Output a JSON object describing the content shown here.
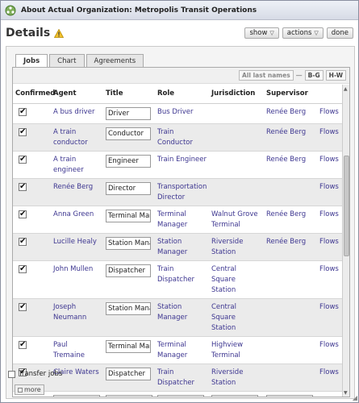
{
  "window": {
    "title": "About Actual Organization: Metropolis Transit Operations"
  },
  "header": {
    "title": "Details",
    "buttons": {
      "show": "show",
      "actions": "actions",
      "done": "done"
    }
  },
  "tabs": [
    "Jobs",
    "Chart",
    "Agreements"
  ],
  "filters": {
    "all": "All last names",
    "sep": "—",
    "bg": "B-G",
    "hw": "H-W"
  },
  "table": {
    "columns": [
      "Confirmed",
      "Agent",
      "Title",
      "Role",
      "Jurisdiction",
      "Supervisor",
      ""
    ],
    "rows": [
      {
        "confirmed": true,
        "agent": "A bus driver",
        "title": "Driver",
        "role": "Bus Driver",
        "jurisdiction": "",
        "supervisor": "Renée Berg",
        "flows": "Flows"
      },
      {
        "confirmed": true,
        "agent": "A train conductor",
        "title": "Conductor",
        "role": "Train Conductor",
        "jurisdiction": "",
        "supervisor": "Renée Berg",
        "flows": "Flows"
      },
      {
        "confirmed": true,
        "agent": "A train engineer",
        "title": "Engineer",
        "role": "Train Engineer",
        "jurisdiction": "",
        "supervisor": "Renée Berg",
        "flows": "Flows"
      },
      {
        "confirmed": true,
        "agent": "Renée Berg",
        "title": "Director",
        "role": "Transportation Director",
        "jurisdiction": "",
        "supervisor": "",
        "flows": "Flows"
      },
      {
        "confirmed": true,
        "agent": "Anna Green",
        "title": "Terminal Manag",
        "role": "Terminal Manager",
        "jurisdiction": "Walnut Grove Terminal",
        "supervisor": "Renée Berg",
        "flows": "Flows"
      },
      {
        "confirmed": true,
        "agent": "Lucille Healy",
        "title": "Station Manage",
        "role": "Station Manager",
        "jurisdiction": "Riverside Station",
        "supervisor": "Renée Berg",
        "flows": "Flows"
      },
      {
        "confirmed": true,
        "agent": "John Mullen",
        "title": "Dispatcher",
        "role": "Train Dispatcher",
        "jurisdiction": "Central Square Station",
        "supervisor": "",
        "flows": "Flows"
      },
      {
        "confirmed": true,
        "agent": "Joseph Neumann",
        "title": "Station Manage",
        "role": "Station Manager",
        "jurisdiction": "Central Square Station",
        "supervisor": "",
        "flows": "Flows"
      },
      {
        "confirmed": true,
        "agent": "Paul Tremaine",
        "title": "Terminal Manag",
        "role": "Terminal Manager",
        "jurisdiction": "Highview Terminal",
        "supervisor": "",
        "flows": "Flows"
      },
      {
        "confirmed": true,
        "agent": "Claire Waters",
        "title": "Dispatcher",
        "role": "Train Dispatcher",
        "jurisdiction": "Riverside Station",
        "supervisor": "",
        "flows": "Flows"
      }
    ]
  },
  "footer": {
    "transfer_label": "Transfer jobs",
    "more_label": "more"
  }
}
